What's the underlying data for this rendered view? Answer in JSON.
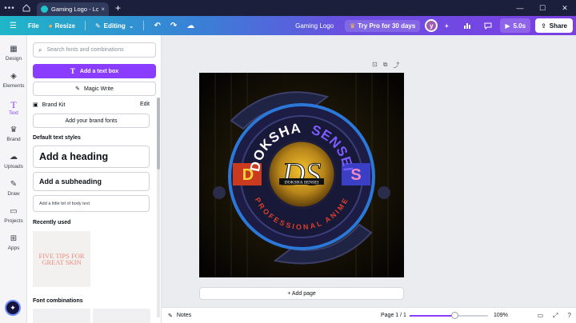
{
  "browser": {
    "tab_title": "Gaming Logo - Logo",
    "tab_close": "×",
    "new_tab": "+"
  },
  "toolbar": {
    "file": "File",
    "resize": "Resize",
    "editing": "Editing",
    "doc_title": "Gaming Logo",
    "try_pro": "Try Pro for 30 days",
    "avatar_letter": "y",
    "play_duration": "5.0s",
    "share": "Share",
    "accent": "#8b3dff"
  },
  "rail": {
    "items": [
      {
        "label": "Design",
        "icon": "layout-icon"
      },
      {
        "label": "Elements",
        "icon": "shapes-icon"
      },
      {
        "label": "Text",
        "icon": "text-icon"
      },
      {
        "label": "Brand",
        "icon": "crown-icon"
      },
      {
        "label": "Uploads",
        "icon": "cloud-upload-icon"
      },
      {
        "label": "Draw",
        "icon": "pen-icon"
      },
      {
        "label": "Projects",
        "icon": "folder-icon"
      },
      {
        "label": "Apps",
        "icon": "apps-grid-icon"
      }
    ]
  },
  "panel": {
    "search_placeholder": "Search fonts and combinations",
    "add_text_box": "Add a text box",
    "magic_write": "Magic Write",
    "brand_kit": "Brand Kit",
    "brand_kit_edit": "Edit",
    "add_brand_fonts": "Add your brand fonts",
    "default_text_styles": "Default text styles",
    "heading": "Add a heading",
    "subheading": "Add a subheading",
    "body_text": "Add a little bit of body text",
    "recently_used": "Recently used",
    "recent_thumb": "FIVE TIPS FOR GREAT SKIN",
    "font_combinations": "Font combinations"
  },
  "logo": {
    "top_text": "DOKSHA",
    "top_text_accent": "SENSEI",
    "bottom_text": "PROFESSIONAL ANIME",
    "left_letter": "D",
    "right_letter": "S",
    "monogram": "DS",
    "monogram_caption": "DOKSHA SENSEI"
  },
  "canvas": {
    "add_page": "+ Add page"
  },
  "bottombar": {
    "notes": "Notes",
    "page_info": "Page 1 / 1",
    "zoom": "109%",
    "zoom_fraction": 0.58
  }
}
